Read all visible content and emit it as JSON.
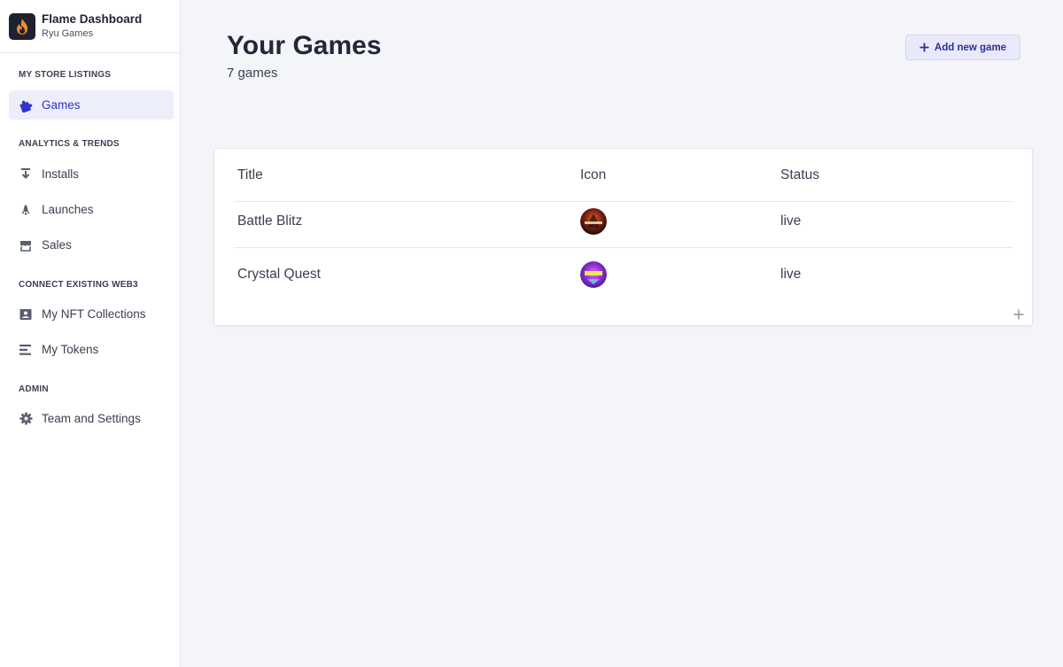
{
  "brand": {
    "title": "Flame Dashboard",
    "subtitle": "Ryu Games"
  },
  "sidebar": {
    "sections": [
      {
        "label": "MY STORE LISTINGS"
      },
      {
        "label": "ANALYTICS & TRENDS"
      },
      {
        "label": "CONNECT EXISTING WEB3"
      },
      {
        "label": "ADMIN"
      }
    ],
    "items": [
      {
        "label": "Games",
        "icon": "puzzle-icon",
        "active": true
      },
      {
        "label": "Installs",
        "icon": "download-icon"
      },
      {
        "label": "Launches",
        "icon": "rocket-icon"
      },
      {
        "label": "Sales",
        "icon": "store-icon"
      },
      {
        "label": "My NFT Collections",
        "icon": "image-icon"
      },
      {
        "label": "My Tokens",
        "icon": "tokens-icon"
      },
      {
        "label": "Team and Settings",
        "icon": "gear-icon"
      }
    ]
  },
  "main": {
    "title": "Your Games",
    "subtitle": "7 games",
    "add_button_label": "Add new game",
    "table": {
      "columns": [
        "Title",
        "Icon",
        "Status"
      ],
      "rows": [
        {
          "title": "Battle Blitz",
          "icon": "battle-blitz-icon",
          "status": "live"
        },
        {
          "title": "Crystal Quest",
          "icon": "crystal-quest-icon",
          "status": "live"
        }
      ]
    }
  },
  "colors": {
    "accent": "#2f36c8",
    "active_bg": "#eceefc",
    "background": "#f4f5f9"
  }
}
